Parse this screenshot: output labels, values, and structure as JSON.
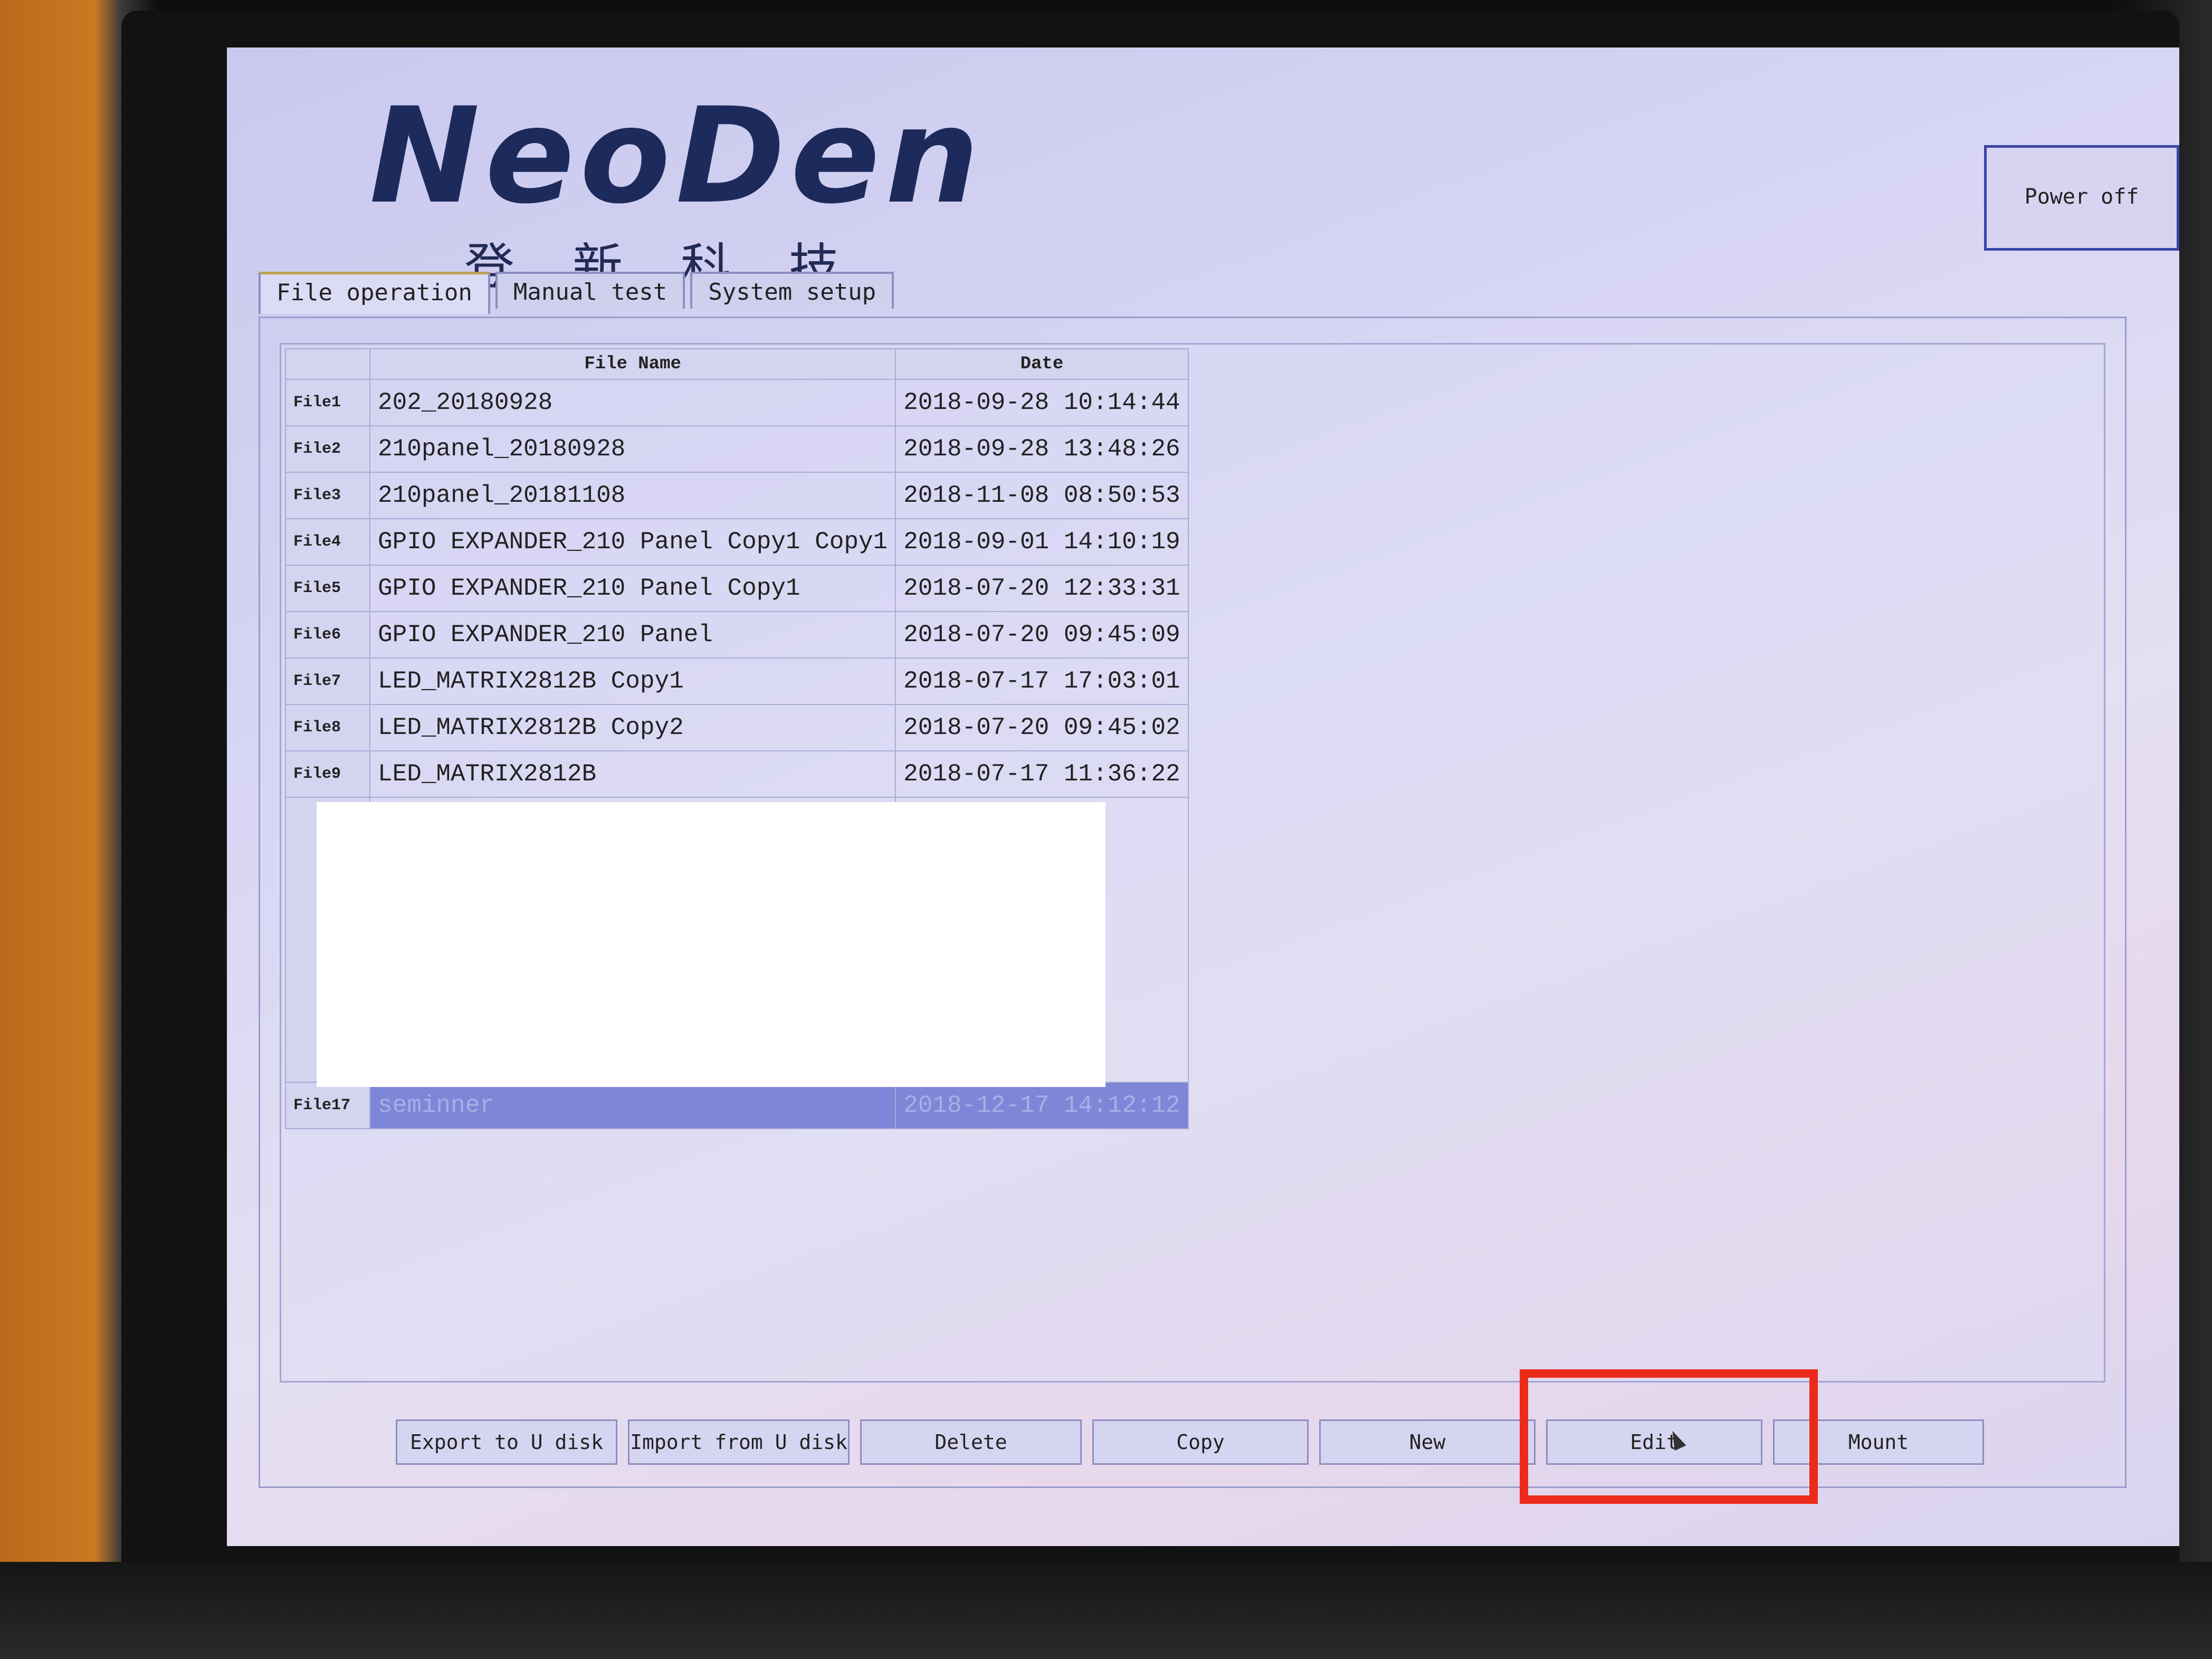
{
  "brand": {
    "logo": "NeoDen",
    "chinese": "登新科技"
  },
  "header": {
    "power_label": "Power off"
  },
  "tabs": [
    {
      "label": "File operation",
      "active": true
    },
    {
      "label": "Manual test",
      "active": false
    },
    {
      "label": "System setup",
      "active": false
    }
  ],
  "table": {
    "headers": [
      "File Name",
      "Date"
    ],
    "rows": [
      {
        "idx": "File1",
        "name": "202_20180928",
        "date": "2018-09-28 10:14:44"
      },
      {
        "idx": "File2",
        "name": "210panel_20180928",
        "date": "2018-09-28 13:48:26"
      },
      {
        "idx": "File3",
        "name": "210panel_20181108",
        "date": "2018-11-08 08:50:53"
      },
      {
        "idx": "File4",
        "name": "GPIO EXPANDER_210 Panel Copy1 Copy1",
        "date": "2018-09-01 14:10:19"
      },
      {
        "idx": "File5",
        "name": "GPIO EXPANDER_210 Panel Copy1",
        "date": "2018-07-20 12:33:31"
      },
      {
        "idx": "File6",
        "name": "GPIO EXPANDER_210 Panel",
        "date": "2018-07-20 09:45:09"
      },
      {
        "idx": "File7",
        "name": "LED_MATRIX2812B Copy1",
        "date": "2018-07-17 17:03:01"
      },
      {
        "idx": "File8",
        "name": "LED_MATRIX2812B Copy2",
        "date": "2018-07-20 09:45:02"
      },
      {
        "idx": "File9",
        "name": "LED_MATRIX2812B",
        "date": "2018-07-17 11:36:22"
      }
    ],
    "selected_row": {
      "idx": "File17",
      "name": "seminner",
      "date": "2018-12-17 14:12:12"
    }
  },
  "buttons": {
    "export": "Export to U disk",
    "import": "Import from U disk",
    "delete": "Delete",
    "copy": "Copy",
    "new": "New",
    "edit": "Edit",
    "mount": "Mount"
  },
  "colors": {
    "highlight": "#ec2a1a",
    "selection": "#7e86d8"
  }
}
